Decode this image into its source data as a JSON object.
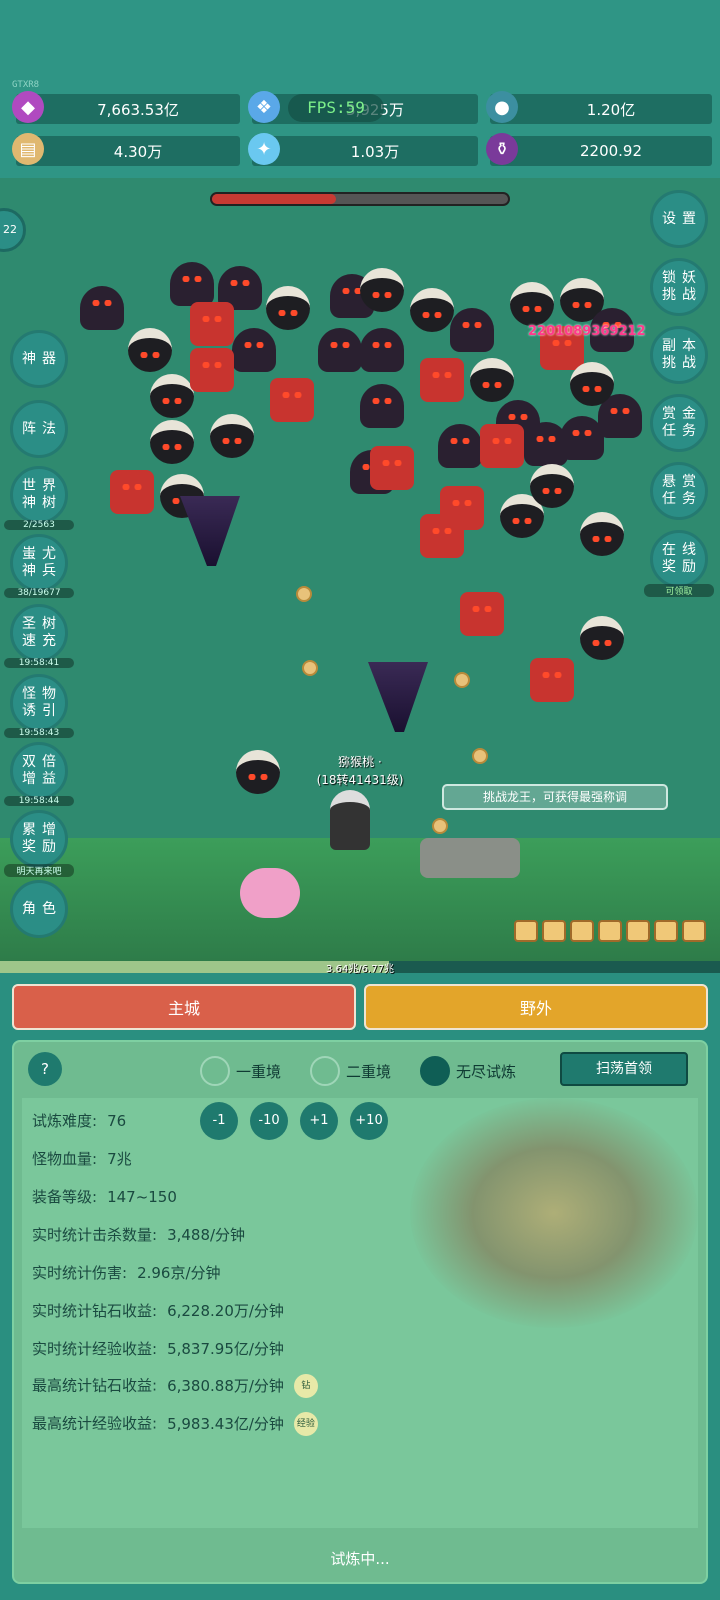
{
  "watermark": "GTXR8",
  "fps": "FPS:59",
  "resources": [
    {
      "icon": "purple-gem-icon",
      "value": "7,663.53亿"
    },
    {
      "icon": "blue-crystal-icon",
      "value": "3,925万"
    },
    {
      "icon": "orb-icon",
      "value": "1.20亿"
    },
    {
      "icon": "scroll-icon",
      "value": "4.30万"
    },
    {
      "icon": "ice-shard-icon",
      "value": "1.03万"
    },
    {
      "icon": "purple-pot-icon",
      "value": "2200.92"
    }
  ],
  "boss_hp_fraction": 0.42,
  "round_badge": "22",
  "left_menu": [
    {
      "label": "神器",
      "sub": ""
    },
    {
      "label": "阵法",
      "sub": ""
    },
    {
      "label": "世界神树",
      "sub": "2/2563"
    },
    {
      "label": "蚩尤神兵",
      "sub": "38/19677"
    },
    {
      "label": "圣树速充",
      "sub": "19:58:41"
    },
    {
      "label": "怪物诱引",
      "sub": "19:58:43"
    },
    {
      "label": "双倍增益",
      "sub": "19:58:44"
    },
    {
      "label": "累增奖励",
      "sub": "明天再来吧"
    },
    {
      "label": "角色",
      "sub": ""
    }
  ],
  "right_menu": [
    {
      "label": "设置",
      "sub": ""
    },
    {
      "label": "锁妖挑战",
      "sub": ""
    },
    {
      "label": "副本挑战",
      "sub": ""
    },
    {
      "label": "赏金任务",
      "sub": ""
    },
    {
      "label": "悬赏任务",
      "sub": ""
    },
    {
      "label": "在线奖励",
      "sub": "可领取"
    }
  ],
  "damage_number": "2201089369212",
  "player": {
    "name": "猕猴桃 ·",
    "level": "(18转41431级)"
  },
  "tip_text": "挑战龙王，可获得最强称调",
  "exp_text": "3.64兆/6.77兆",
  "exp_fraction": 0.54,
  "tabs": {
    "main_city": "主城",
    "wild": "野外"
  },
  "help_label": "?",
  "modes": [
    {
      "label": "一重境",
      "selected": false
    },
    {
      "label": "二重境",
      "selected": false
    },
    {
      "label": "无尽试炼",
      "selected": true
    }
  ],
  "sweep_label": "扫荡首领",
  "adjust_buttons": [
    "-1",
    "-10",
    "+1",
    "+10"
  ],
  "stats": [
    {
      "label": "试炼难度:",
      "value": "76",
      "badge": ""
    },
    {
      "label": "怪物血量:",
      "value": "7兆",
      "badge": ""
    },
    {
      "label": "装备等级:",
      "value": "147~150",
      "badge": ""
    },
    {
      "label": "实时统计击杀数量:",
      "value": "3,488/分钟",
      "badge": ""
    },
    {
      "label": "实时统计伤害:",
      "value": "2.96京/分钟",
      "badge": ""
    },
    {
      "label": "实时统计钻石收益:",
      "value": "6,228.20万/分钟",
      "badge": ""
    },
    {
      "label": "实时统计经验收益:",
      "value": "5,837.95亿/分钟",
      "badge": ""
    },
    {
      "label": "最高统计钻石收益:",
      "value": "6,380.88万/分钟",
      "badge": "钻"
    },
    {
      "label": "最高统计经验收益:",
      "value": "5,983.43亿/分钟",
      "badge": "经验"
    }
  ],
  "status_text": "试炼中...",
  "colors": {
    "main_city_tab": "#d9604a",
    "wild_tab": "#e3a52a",
    "accent": "#1f7a6e"
  }
}
